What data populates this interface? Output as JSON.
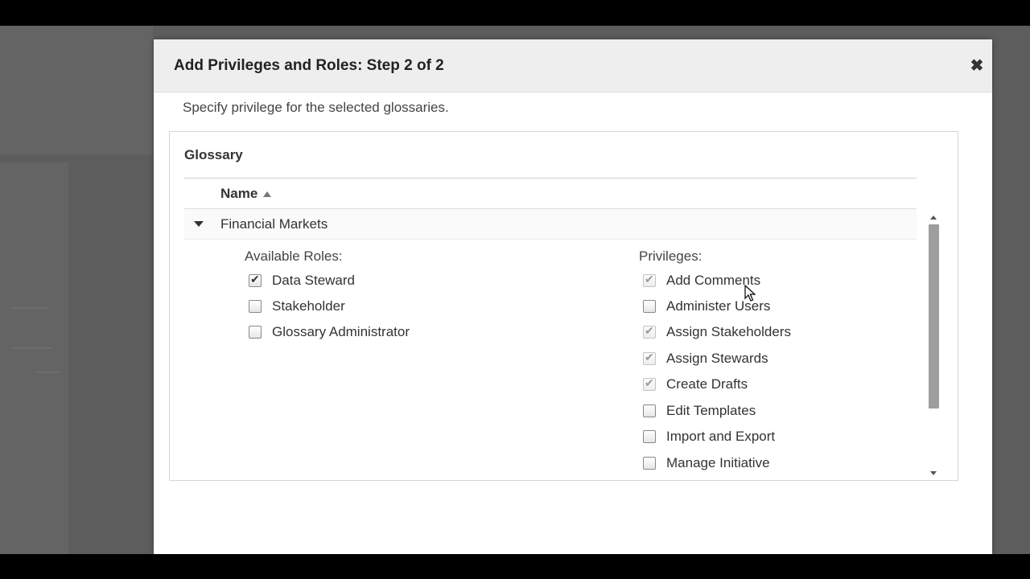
{
  "modal": {
    "title": "Add Privileges and Roles: Step 2 of 2",
    "close_glyph": "✖",
    "subtitle": "Specify privilege for the selected glossaries."
  },
  "panel": {
    "heading": "Glossary",
    "column_header": "Name",
    "group": {
      "label": "Financial Markets",
      "available_roles_label": "Available Roles:",
      "privileges_label": "Privileges:",
      "roles": [
        {
          "label": "Data Steward",
          "checked": true
        },
        {
          "label": "Stakeholder",
          "checked": false
        },
        {
          "label": "Glossary Administrator",
          "checked": false
        }
      ],
      "privileges": [
        {
          "label": "Add Comments",
          "checked": true,
          "disabled": true
        },
        {
          "label": "Administer Users",
          "checked": false,
          "disabled": false
        },
        {
          "label": "Assign Stakeholders",
          "checked": true,
          "disabled": true
        },
        {
          "label": "Assign Stewards",
          "checked": true,
          "disabled": true
        },
        {
          "label": "Create Drafts",
          "checked": true,
          "disabled": true
        },
        {
          "label": "Edit Templates",
          "checked": false,
          "disabled": false
        },
        {
          "label": "Import and Export",
          "checked": false,
          "disabled": false
        },
        {
          "label": "Manage Initiative",
          "checked": false,
          "disabled": false
        }
      ]
    }
  }
}
